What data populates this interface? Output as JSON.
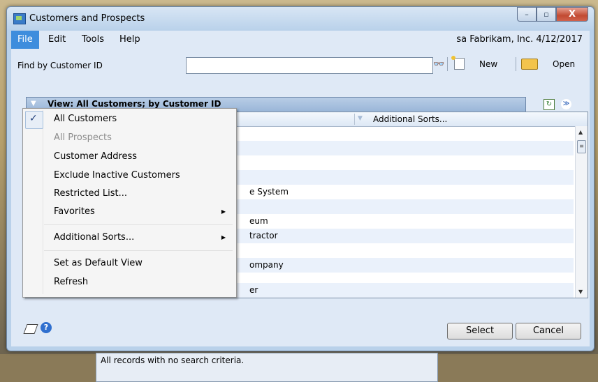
{
  "window": {
    "title": "Customers and Prospects",
    "min_glyph": "–",
    "max_glyph": "▫",
    "close_glyph": "X"
  },
  "menu": {
    "items": [
      "File",
      "Edit",
      "Tools",
      "Help"
    ],
    "right_info": "sa  Fabrikam, Inc.  4/12/2017"
  },
  "toolbar": {
    "find_label": "Find by Customer ID",
    "find_value": "",
    "new_label": "New",
    "open_label": "Open"
  },
  "view": {
    "label": "View: All Customers; by Customer ID"
  },
  "list": {
    "sort_header": "Additional Sorts...",
    "rows": [
      "",
      "",
      "",
      "",
      "e System",
      "",
      "eum",
      "tractor",
      "",
      "ompany",
      "",
      "er"
    ]
  },
  "popup": {
    "items": [
      {
        "label": "All Customers",
        "checked": true,
        "disabled": false,
        "submenu": false
      },
      {
        "label": "All Prospects",
        "checked": false,
        "disabled": true,
        "submenu": false
      },
      {
        "label": "Customer Address",
        "checked": false,
        "disabled": false,
        "submenu": false
      },
      {
        "label": "Exclude Inactive Customers",
        "checked": false,
        "disabled": false,
        "submenu": false
      },
      {
        "label": "Restricted List...",
        "checked": false,
        "disabled": false,
        "submenu": false
      },
      {
        "label": "Favorites",
        "checked": false,
        "disabled": false,
        "submenu": true
      },
      {
        "label": "Additional Sorts...",
        "checked": false,
        "disabled": false,
        "submenu": true
      },
      {
        "label": "Set as Default View",
        "checked": false,
        "disabled": false,
        "submenu": false
      },
      {
        "label": "Refresh",
        "checked": false,
        "disabled": false,
        "submenu": false
      }
    ]
  },
  "status": {
    "text": "All records with no search criteria."
  },
  "buttons": {
    "select": "Select",
    "cancel": "Cancel"
  },
  "icons": {
    "app": "customers-app-icon",
    "find": "binoculars-icon",
    "new": "new-document-icon",
    "open": "open-folder-icon",
    "refresh": "refresh-icon",
    "expand": "expand-chevron-icon",
    "note": "note-icon",
    "help": "help-icon"
  },
  "colors": {
    "active_menu": "#3e8ddd",
    "window_frame": "#b9d1ea",
    "close_button": "#c24a32"
  }
}
